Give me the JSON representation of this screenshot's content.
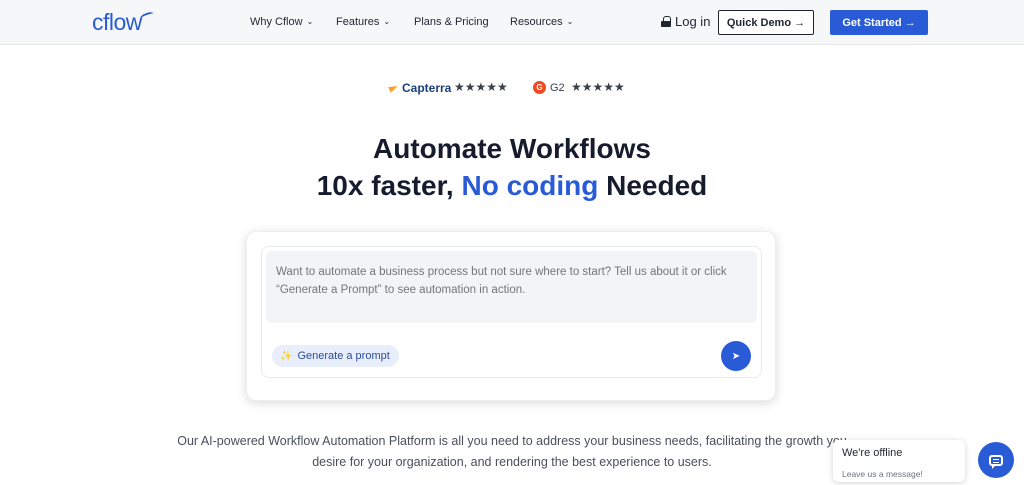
{
  "nav": {
    "logo": "cflow",
    "items": [
      {
        "label": "Why Cflow",
        "has_dropdown": true
      },
      {
        "label": "Features",
        "has_dropdown": true
      },
      {
        "label": "Plans & Pricing",
        "has_dropdown": false
      },
      {
        "label": "Resources",
        "has_dropdown": true
      }
    ],
    "login_label": "Log in",
    "demo_label": "Quick Demo →",
    "start_label": "Get Started →"
  },
  "ratings": {
    "capterra_label": "Capterra",
    "capterra_stars": "★★★★★",
    "capterra_rating": 4.5,
    "g2_icon": "G",
    "g2_label": "G2",
    "g2_stars": "★★★★★",
    "g2_rating": 4.5
  },
  "hero": {
    "line1": "Automate Workflows",
    "line2_part1": "10x faster, ",
    "line2_highlight": "No coding",
    "line2_part2": " Needed"
  },
  "prompt": {
    "placeholder": "Want to automate a business process but not sure where to start? Tell us about it or click “Generate a Prompt” to see automation in action.",
    "generate_label": "Generate a prompt",
    "send_icon": "send-icon"
  },
  "description": "Our AI-powered Workflow Automation Platform is all you need to address your business needs, facilitating the growth you desire for your organization, and rendering the best experience to users.",
  "chat": {
    "title": "We're offline",
    "subtitle": "Leave us a message!"
  },
  "colors": {
    "accent": "#2a5bd7",
    "text_dark": "#161b2e",
    "star_gray": "#3b3f48"
  }
}
